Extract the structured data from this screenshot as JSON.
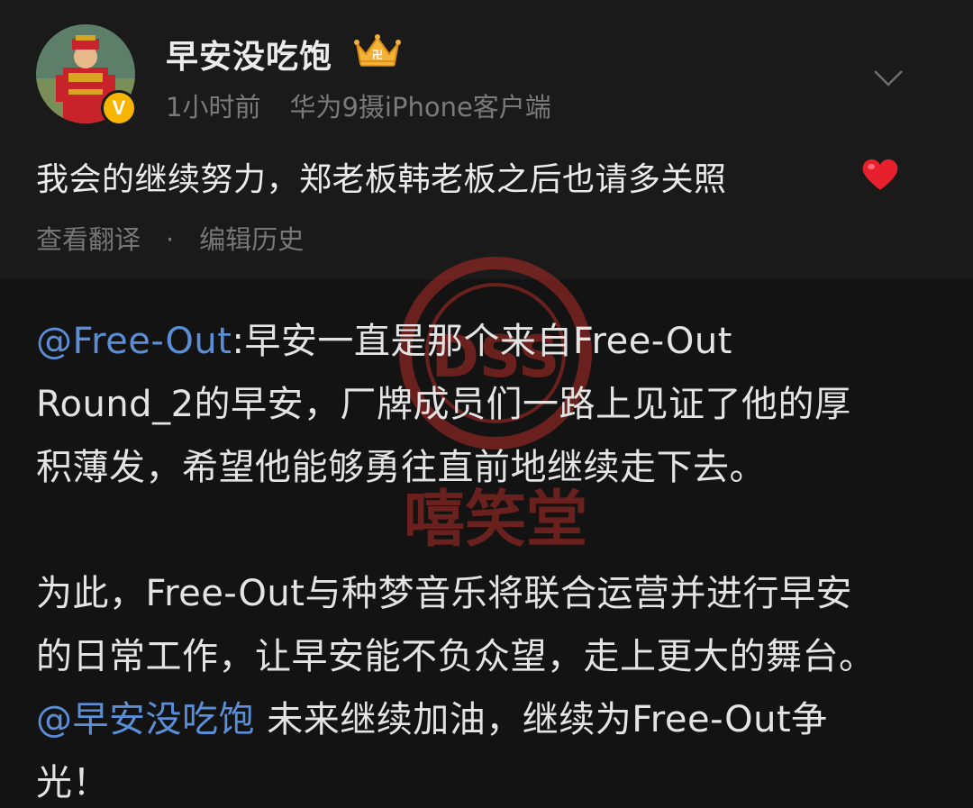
{
  "post": {
    "author": {
      "name": "早安没吃饱",
      "verified_badge": "V"
    },
    "time": "1小时前",
    "source": "华为9摄iPhone客户端",
    "text": "我会的继续努力，郑老板韩老板之后也请多关照",
    "actions": {
      "translate": "查看翻译",
      "separator": "·",
      "edit_history": "编辑历史"
    }
  },
  "watermark": {
    "logo_text": "DSS",
    "brand_text": "嘻笑堂"
  },
  "comment": {
    "mention1": "@Free-Out",
    "line1_rest": ":早安一直是那个来自Free-Out",
    "line2": "Round_2的早安，厂牌成员们一路上见证了他的厚",
    "line3": "积薄发，希望他能够勇往直前地继续走下去。",
    "line4": "为此，Free-Out与种梦音乐将联合运营并进行早安",
    "line5": "的日常工作，让早安能不负众望，走上更大的舞台。",
    "mention2": "@早安没吃饱",
    "line6_rest": " 未来继续加油，继续为Free-Out争",
    "line7": "光！"
  },
  "colors": {
    "mention": "#5a8fd8",
    "verified": "#f7b500",
    "watermark": "#c0392b"
  },
  "icons": [
    "crown-icon",
    "chevron-down-icon",
    "heart-emoji-icon",
    "verified-icon"
  ]
}
